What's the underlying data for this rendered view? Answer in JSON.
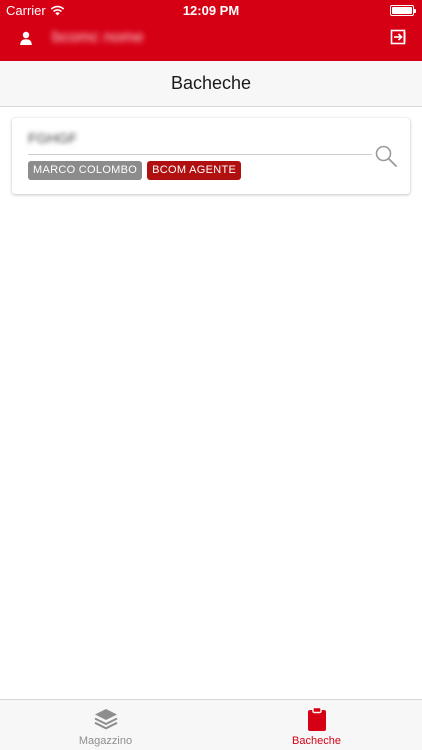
{
  "status_bar": {
    "carrier": "Carrier",
    "time": "12:09 PM"
  },
  "header": {
    "user_name": "bcomc nome",
    "user_icon": "user-icon",
    "logout_icon": "logout-icon"
  },
  "page": {
    "title": "Bacheche"
  },
  "search_card": {
    "value": "FGHGF",
    "search_icon": "search-icon",
    "chips": [
      {
        "label": "MARCO COLOMBO",
        "color": "#8c8c8c"
      },
      {
        "label": "BCOM AGENTE",
        "color": "#b01010"
      }
    ]
  },
  "tab_bar": {
    "tabs": [
      {
        "label": "Magazzino",
        "icon": "layers-icon",
        "active": false
      },
      {
        "label": "Bacheche",
        "icon": "clipboard-icon",
        "active": true
      }
    ]
  },
  "colors": {
    "brand_red": "#d60015",
    "inactive_grey": "#8e8e8e"
  }
}
